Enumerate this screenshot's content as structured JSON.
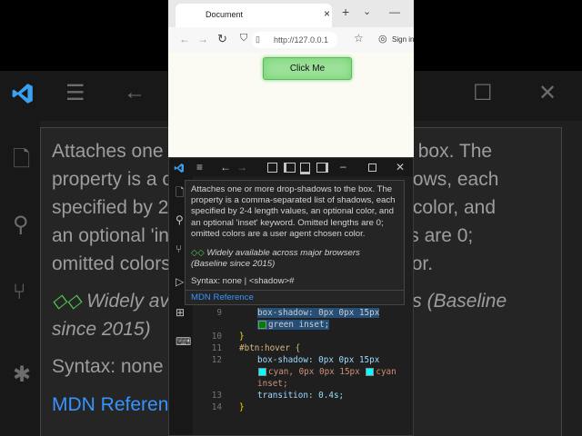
{
  "browser": {
    "tab_title": "Document",
    "tab_close": "×",
    "new_tab": "+",
    "url": "http://127.0.0.1",
    "sign_in": "Sign in",
    "button_label": "Click Me"
  },
  "hover": {
    "description": "Attaches one or more drop-shadows to the box. The property is a comma-separated list of shadows, each specified by 2-4 length values, an optional color, and an optional 'inset' keyword. Omitted lengths are 0; omitted colors are a user agent chosen color.",
    "baseline": "Widely available across major browsers (Baseline since 2015)",
    "syntax": "Syntax: none | <shadow>#",
    "reference": "MDN Reference"
  },
  "background": {
    "lines": [
      "Attaches one or more drop-shadows to the box. The",
      "property is a comma-separated list of shadows, each",
      "specified by 2-4 length values, an optional color, and",
      "an optional 'inset' keyword. Omitted lengths are 0;",
      "omitted colors are a user agent chosen color."
    ],
    "baseline": "Widely available across major browsers (Baseline",
    "baseline2": "since 2015)",
    "syntax": "Syntax: none | <shadow>#",
    "reference": "MDN Reference"
  },
  "code": {
    "lines": [
      {
        "n": "9",
        "t1": "box-shadow: 0px 0px 15px",
        "t2": "green inset;"
      },
      {
        "n": "10",
        "t": "}"
      },
      {
        "n": "11",
        "t": "#btn:hover {"
      },
      {
        "n": "12",
        "t1": "box-shadow: 0px 0px 15px",
        "t2a": "cyan, 0px 0px 15px",
        "t2b": "cyan",
        "t3": "inset;"
      },
      {
        "n": "13",
        "t": "transition: 0.4s;"
      },
      {
        "n": "14",
        "t": "}"
      }
    ]
  },
  "colors": {
    "green": "#008000",
    "cyan": "#00ffff",
    "button": "#9de09a"
  },
  "icons": [
    "vscode-logo-icon",
    "menu-icon",
    "back-icon",
    "forward-icon",
    "layout-icon",
    "minimize-icon",
    "maximize-icon",
    "close-icon",
    "files-icon",
    "search-icon",
    "source-control-icon",
    "debug-icon",
    "extensions-icon",
    "remote-icon"
  ]
}
